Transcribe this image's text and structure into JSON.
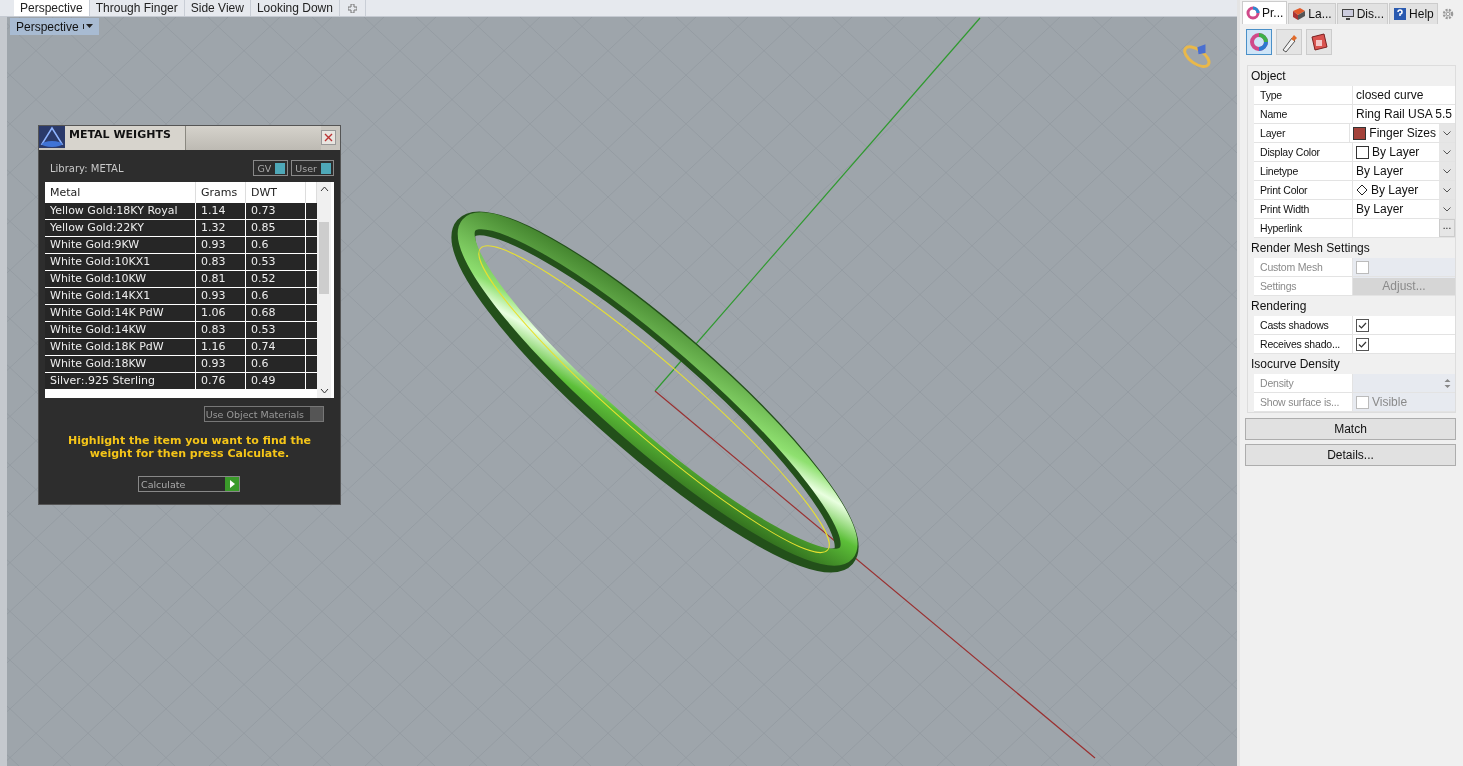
{
  "viewport_tabs": [
    {
      "label": "Perspective",
      "selected": true
    },
    {
      "label": "Through Finger",
      "selected": false
    },
    {
      "label": "Side View",
      "selected": false
    },
    {
      "label": "Looking Down",
      "selected": false
    }
  ],
  "viewport": {
    "label": "Perspective"
  },
  "metal_weights": {
    "title": "METAL WEIGHTS",
    "library": "Library: METAL",
    "toggles": [
      {
        "label": "GV",
        "on": true
      },
      {
        "label": "User",
        "on": true
      }
    ],
    "table": {
      "columns": [
        "Metal",
        "Grams",
        "DWT"
      ],
      "rows": [
        [
          "Yellow Gold:18KY Royal",
          "1.14",
          "0.73"
        ],
        [
          "Yellow Gold:22KY",
          "1.32",
          "0.85"
        ],
        [
          "White Gold:9KW",
          "0.93",
          "0.6"
        ],
        [
          "White Gold:10KX1",
          "0.83",
          "0.53"
        ],
        [
          "White Gold:10KW",
          "0.81",
          "0.52"
        ],
        [
          "White Gold:14KX1",
          "0.93",
          "0.6"
        ],
        [
          "White Gold:14K PdW",
          "1.06",
          "0.68"
        ],
        [
          "White Gold:14KW",
          "0.83",
          "0.53"
        ],
        [
          "White Gold:18K PdW",
          "1.16",
          "0.74"
        ],
        [
          "White Gold:18KW",
          "0.93",
          "0.6"
        ],
        [
          "Silver:.925 Sterling",
          "0.76",
          "0.49"
        ]
      ]
    },
    "use_object_materials": {
      "label": "Use Object Materials",
      "checked": false
    },
    "hint": "Highlight the item you want to find the weight for then press Calculate.",
    "calculate_button": "Calculate"
  },
  "properties": {
    "tabs": [
      {
        "label": "Pr...",
        "selected": true
      },
      {
        "label": "La...",
        "selected": false
      },
      {
        "label": "Dis...",
        "selected": false
      },
      {
        "label": "Help",
        "selected": false
      }
    ],
    "tools": [
      {
        "selected": true
      },
      {
        "selected": false
      },
      {
        "selected": false
      }
    ],
    "sections": [
      {
        "title": "Object",
        "rows": [
          {
            "kind": "text",
            "label": "Type",
            "value": "closed curve",
            "disabled": false
          },
          {
            "kind": "text",
            "label": "Name",
            "value": "Ring Rail USA 5.5",
            "disabled": false
          },
          {
            "kind": "color-select",
            "label": "Layer",
            "value": "Finger Sizes",
            "color": "#a3423a",
            "disabled": false
          },
          {
            "kind": "color-select",
            "label": "Display Color",
            "value": "By Layer",
            "color": "#ffffff",
            "disabled": false
          },
          {
            "kind": "select",
            "label": "Linetype",
            "value": "By Layer",
            "disabled": false
          },
          {
            "kind": "diamond-select",
            "label": "Print Color",
            "value": "By Layer",
            "disabled": false
          },
          {
            "kind": "select",
            "label": "Print Width",
            "value": "By Layer",
            "disabled": false
          },
          {
            "kind": "link",
            "label": "Hyperlink",
            "button": "...",
            "disabled": false
          }
        ]
      },
      {
        "title": "Render Mesh Settings",
        "rows": [
          {
            "kind": "checkbox",
            "label": "Custom Mesh",
            "checked": false,
            "disabled": true
          },
          {
            "kind": "button",
            "label": "Settings",
            "button": "Adjust...",
            "disabled": true
          }
        ]
      },
      {
        "title": "Rendering",
        "rows": [
          {
            "kind": "checkbox",
            "label": "Casts shadows",
            "checked": true,
            "disabled": false
          },
          {
            "kind": "checkbox",
            "label": "Receives shado...",
            "checked": true,
            "disabled": false
          }
        ]
      },
      {
        "title": "Isocurve Density",
        "rows": [
          {
            "kind": "spinner",
            "label": "Density",
            "disabled": true
          },
          {
            "kind": "checkbox",
            "label": "Show surface is...",
            "checked": false,
            "value": "Visible",
            "disabled": true
          }
        ]
      }
    ],
    "buttons": [
      "Match",
      "Details..."
    ]
  }
}
